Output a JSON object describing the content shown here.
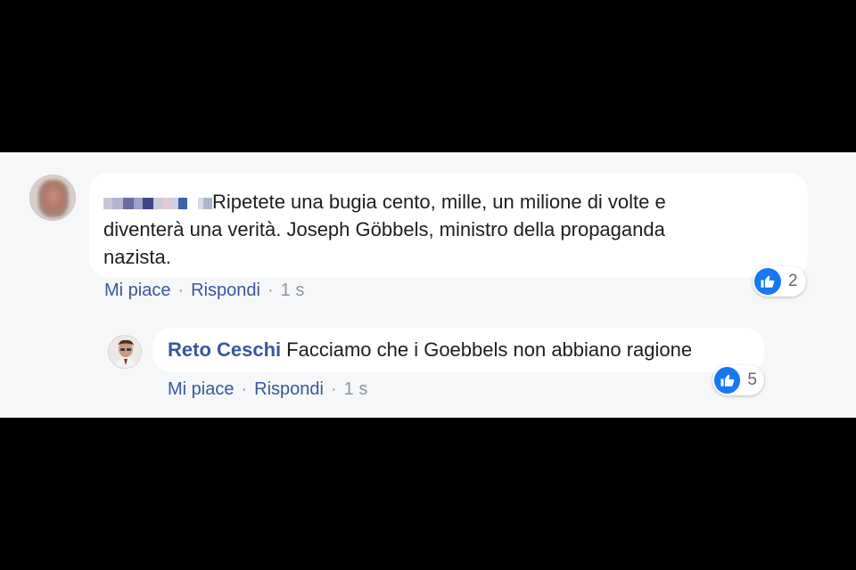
{
  "comments": [
    {
      "author": "",
      "text_line1": "Ripetete una bugia cento, mille, un milione di volte e",
      "text_line2": "diventerà una verità. Joseph Göbbels, ministro della propaganda",
      "text_line3": "nazista.",
      "actions": {
        "like": "Mi piace",
        "reply": "Rispondi",
        "separator": "·",
        "time": "1 s"
      },
      "reaction_icon": "like-icon",
      "reaction_count": "2"
    },
    {
      "author": "Reto Ceschi",
      "text": "Facciamo che i Goebbels non abbiano ragione",
      "actions": {
        "like": "Mi piace",
        "reply": "Rispondi",
        "separator": "·",
        "time": "1 s"
      },
      "reaction_icon": "like-icon",
      "reaction_count": "5"
    }
  ],
  "colors": {
    "like_blue": "#1877f2",
    "author_blue": "#385898",
    "bubble_bg": "#ffffff",
    "band_bg": "#f6f7f9"
  }
}
